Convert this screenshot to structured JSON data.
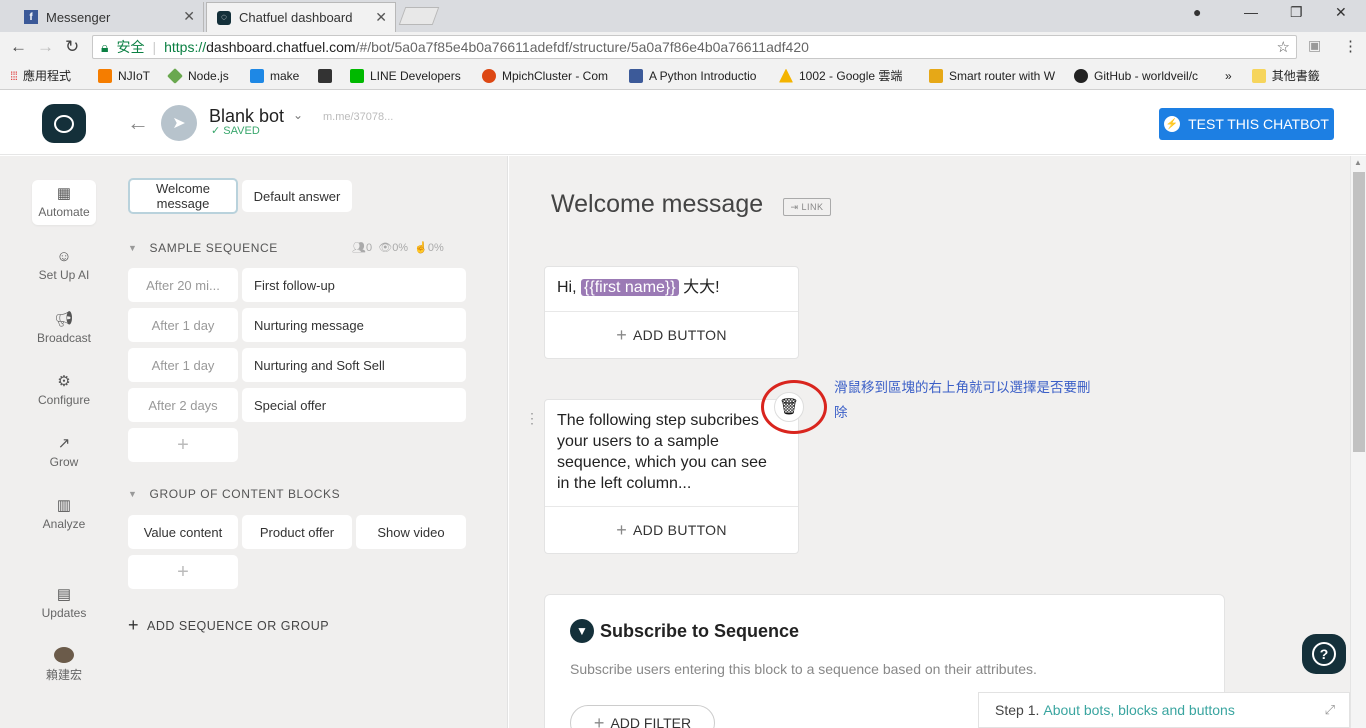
{
  "browser": {
    "tabs": [
      {
        "title": "Messenger",
        "icon": "facebook-icon",
        "active": false
      },
      {
        "title": "Chatfuel dashboard",
        "icon": "chatfuel-icon",
        "active": true
      }
    ],
    "security_label": "安全",
    "url_proto": "https://",
    "url_host": "dashboard.chatfuel.com",
    "url_path": "/#/bot/5a0a7f85e4b0a76611adefdf/structure/5a0a7f86e4b0a76611adf420",
    "bookmarks": [
      {
        "label": "應用程式",
        "icon": "apps-icon",
        "color": "#e8453c"
      },
      {
        "label": "NJIoT",
        "icon": "blogger-icon",
        "color": "#f57d00"
      },
      {
        "label": "Node.js",
        "icon": "nodejs-icon",
        "color": "#6aa84f"
      },
      {
        "label": "make",
        "icon": "make-icon",
        "color": "#1e88e5"
      },
      {
        "label": "",
        "icon": "cat-icon",
        "color": "#333333"
      },
      {
        "label": "LINE Developers",
        "icon": "line-icon",
        "color": "#00b900"
      },
      {
        "label": "MpichCluster - Com",
        "icon": "ubuntu-icon",
        "color": "#dd4814"
      },
      {
        "label": "A Python Introductio",
        "icon": "grid-icon",
        "color": "#3c5a99"
      },
      {
        "label": "1002 - Google 雲端",
        "icon": "drive-icon",
        "color": "#f4b400"
      },
      {
        "label": "Smart router with W",
        "icon": "router-icon",
        "color": "#e6a817"
      },
      {
        "label": "GitHub - worldveil/c",
        "icon": "github-icon",
        "color": "#222222"
      }
    ],
    "bookmarks_more": "»",
    "other_bookmarks": "其他書籤"
  },
  "header": {
    "bot_name": "Blank bot",
    "saved": "SAVED",
    "mme": "m.me/37078...",
    "test_button": "TEST THIS CHATBOT"
  },
  "leftnav": [
    {
      "label": "Automate",
      "icon": "automate-icon",
      "active": true
    },
    {
      "label": "Set Up AI",
      "icon": "ai-icon",
      "active": false
    },
    {
      "label": "Broadcast",
      "icon": "megaphone-icon",
      "active": false
    },
    {
      "label": "Configure",
      "icon": "gear-icon",
      "active": false
    },
    {
      "label": "Grow",
      "icon": "grow-icon",
      "active": false
    },
    {
      "label": "Analyze",
      "icon": "bar-chart-icon",
      "active": false
    },
    {
      "label": "Updates",
      "icon": "updates-icon",
      "active": false
    },
    {
      "label": "賴建宏",
      "icon": "avatar",
      "active": false
    }
  ],
  "structure": {
    "top_blocks": [
      "Welcome message",
      "Default answer"
    ],
    "sequence_title": "SAMPLE SEQUENCE",
    "sequence_stats": {
      "users": "0",
      "seen": "0%",
      "clicked": "0%"
    },
    "sequence_rows": [
      {
        "delay": "After 20 mi...",
        "name": "First follow-up"
      },
      {
        "delay": "After 1 day",
        "name": "Nurturing message"
      },
      {
        "delay": "After 1 day",
        "name": "Nurturing and Soft Sell"
      },
      {
        "delay": "After 2 days",
        "name": "Special offer"
      }
    ],
    "group_title": "GROUP OF CONTENT BLOCKS",
    "group_blocks": [
      "Value content",
      "Product offer",
      "Show video"
    ],
    "add_label": "ADD SEQUENCE OR GROUP"
  },
  "editor": {
    "title": "Welcome message",
    "link_label": "LINK",
    "card1": {
      "prefix": "Hi, ",
      "variable": "{{first name}}",
      "suffix": " 大大!"
    },
    "card2_text": "The following step subcribes your users to a sample sequence, which you can see in the left column...",
    "add_button_label": "ADD BUTTON",
    "annotation": "滑鼠移到區塊的右上角就可以選擇是否要刪除",
    "subscribe_title": "Subscribe to Sequence",
    "subscribe_desc": "Subscribe users entering this block to a sequence based on their attributes.",
    "add_filter": "ADD FILTER",
    "step_prefix": "Step 1.",
    "step_link": "About bots, blocks and buttons"
  }
}
